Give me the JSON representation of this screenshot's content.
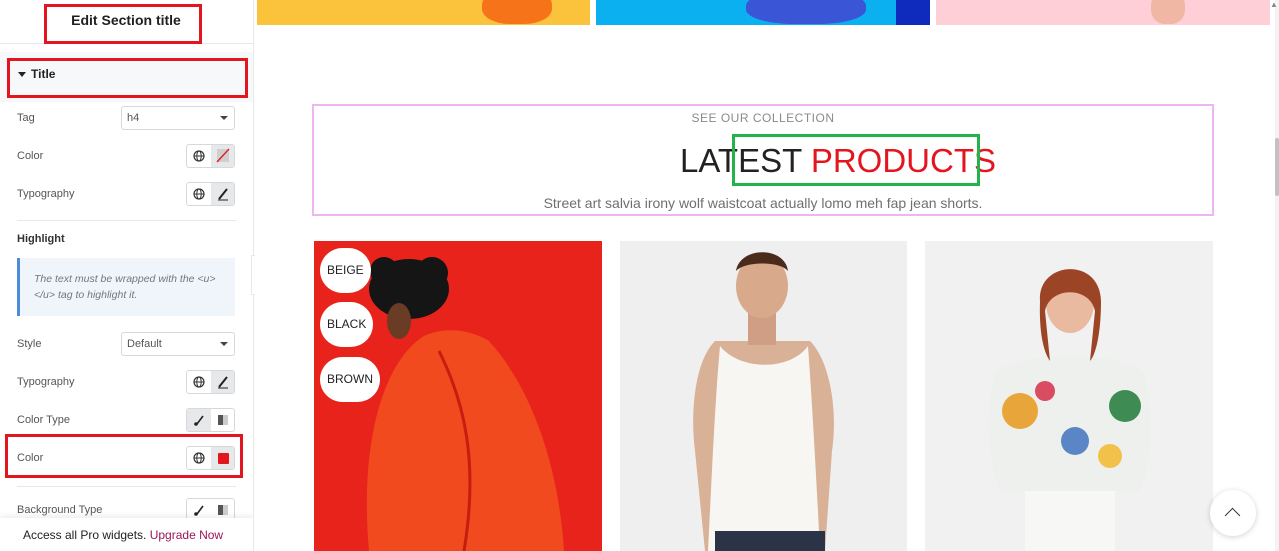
{
  "panel": {
    "header_title": "Edit Section title",
    "section_label": "Title",
    "tag": {
      "label": "Tag",
      "value": "h4"
    },
    "title_color": {
      "label": "Color"
    },
    "title_typography": {
      "label": "Typography"
    },
    "highlight": {
      "heading": "Highlight",
      "note": "The text must be wrapped with the <u></u> tag to highlight it.",
      "style": {
        "label": "Style",
        "value": "Default"
      },
      "typography": {
        "label": "Typography"
      },
      "color_type": {
        "label": "Color Type"
      },
      "color": {
        "label": "Color",
        "swatch": "#e3161f"
      },
      "background_type": {
        "label": "Background Type"
      }
    },
    "promo": {
      "text": "Access all Pro widgets. ",
      "link": "Upgrade Now"
    }
  },
  "preview": {
    "subtitle": "SEE OUR COLLECTION",
    "title_plain": "LATEST ",
    "title_highlight": "PRODUCTS",
    "description": "Street art salvia irony wolf waistcoat actually lomo meh fap jean shorts.",
    "color_pills": [
      "BEIGE",
      "BLACK",
      "BROWN"
    ]
  },
  "colors": {
    "accent_red": "#e3161f",
    "annotation_green": "#24b24b",
    "upgrade_link": "#9c1458"
  },
  "icons": [
    "globe-icon",
    "pencil-icon",
    "brush-icon",
    "gradient-icon",
    "chevron-up-icon",
    "chevron-left-icon",
    "caret-down-icon"
  ]
}
